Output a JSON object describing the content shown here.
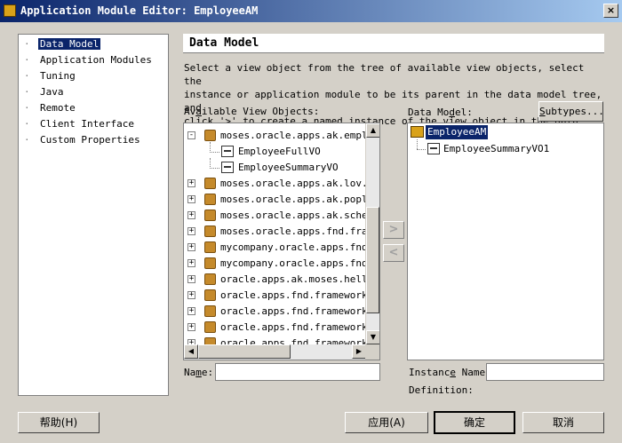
{
  "window": {
    "title": "Application Module Editor: EmployeeAM",
    "close_glyph": "×"
  },
  "nav": {
    "items": [
      {
        "label": "Data Model",
        "selected": true
      },
      {
        "label": "Application Modules"
      },
      {
        "label": "Tuning"
      },
      {
        "label": "Java"
      },
      {
        "label": "Remote"
      },
      {
        "label": "Client Interface"
      },
      {
        "label": "Custom Properties"
      }
    ]
  },
  "page": {
    "title": "Data Model",
    "description_lines": [
      "Select a view object from the tree of available view objects, select the",
      "instance or application module to be its parent in the data model tree, and",
      "click '>' to create a named instance of the view object in the data model."
    ]
  },
  "available": {
    "label_pre": "Av",
    "label_ul": "a",
    "label_post": "ilable View Objects:",
    "rows": [
      {
        "text": "moses.oracle.apps.ak.employee",
        "type": "package",
        "expanded": true,
        "level": 0
      },
      {
        "text": "EmployeeFullVO",
        "type": "vo",
        "level": 1
      },
      {
        "text": "EmployeeSummaryVO",
        "type": "vo",
        "level": 1
      },
      {
        "text": "moses.oracle.apps.ak.lov.server",
        "type": "package",
        "level": 0
      },
      {
        "text": "moses.oracle.apps.ak.poplist.server",
        "type": "package",
        "level": 0
      },
      {
        "text": "moses.oracle.apps.ak.schema.server",
        "type": "package",
        "level": 0
      },
      {
        "text": "moses.oracle.apps.fnd.framework",
        "type": "package",
        "level": 0
      },
      {
        "text": "mycompany.oracle.apps.fnd.framework",
        "type": "package",
        "level": 0
      },
      {
        "text": "mycompany.oracle.apps.fnd.framework",
        "type": "package",
        "level": 0
      },
      {
        "text": "oracle.apps.ak.moses.hello.server",
        "type": "package",
        "level": 0
      },
      {
        "text": "oracle.apps.fnd.framework.toolbox",
        "type": "package",
        "level": 0
      },
      {
        "text": "oracle.apps.fnd.framework.toolbox",
        "type": "package",
        "level": 0
      },
      {
        "text": "oracle.apps.fnd.framework.toolbox",
        "type": "package",
        "level": 0
      },
      {
        "text": "oracle.apps.fnd.framework.toolbox",
        "type": "package",
        "level": 0
      }
    ]
  },
  "data_model": {
    "label_pre": "Data Mo",
    "label_ul": "d",
    "label_post": "el:",
    "subtypes_pre": "",
    "subtypes_ul": "S",
    "subtypes_post": "ubtypes...",
    "root": "EmployeeAM",
    "children": [
      "EmployeeSummaryVO1"
    ]
  },
  "name_field": {
    "label_pre": "Na",
    "label_ul": "m",
    "label_post": "e:",
    "value": ""
  },
  "instance_field": {
    "label_pre": "Instanc",
    "label_ul": "e",
    "label_post": " Name:",
    "value": ""
  },
  "definition_label": "Definition:",
  "buttons": {
    "help": "帮助(H)",
    "apply": "应用(A)",
    "ok": "确定",
    "cancel": "取消"
  },
  "move_buttons": {
    "add": ">",
    "remove": "<"
  }
}
